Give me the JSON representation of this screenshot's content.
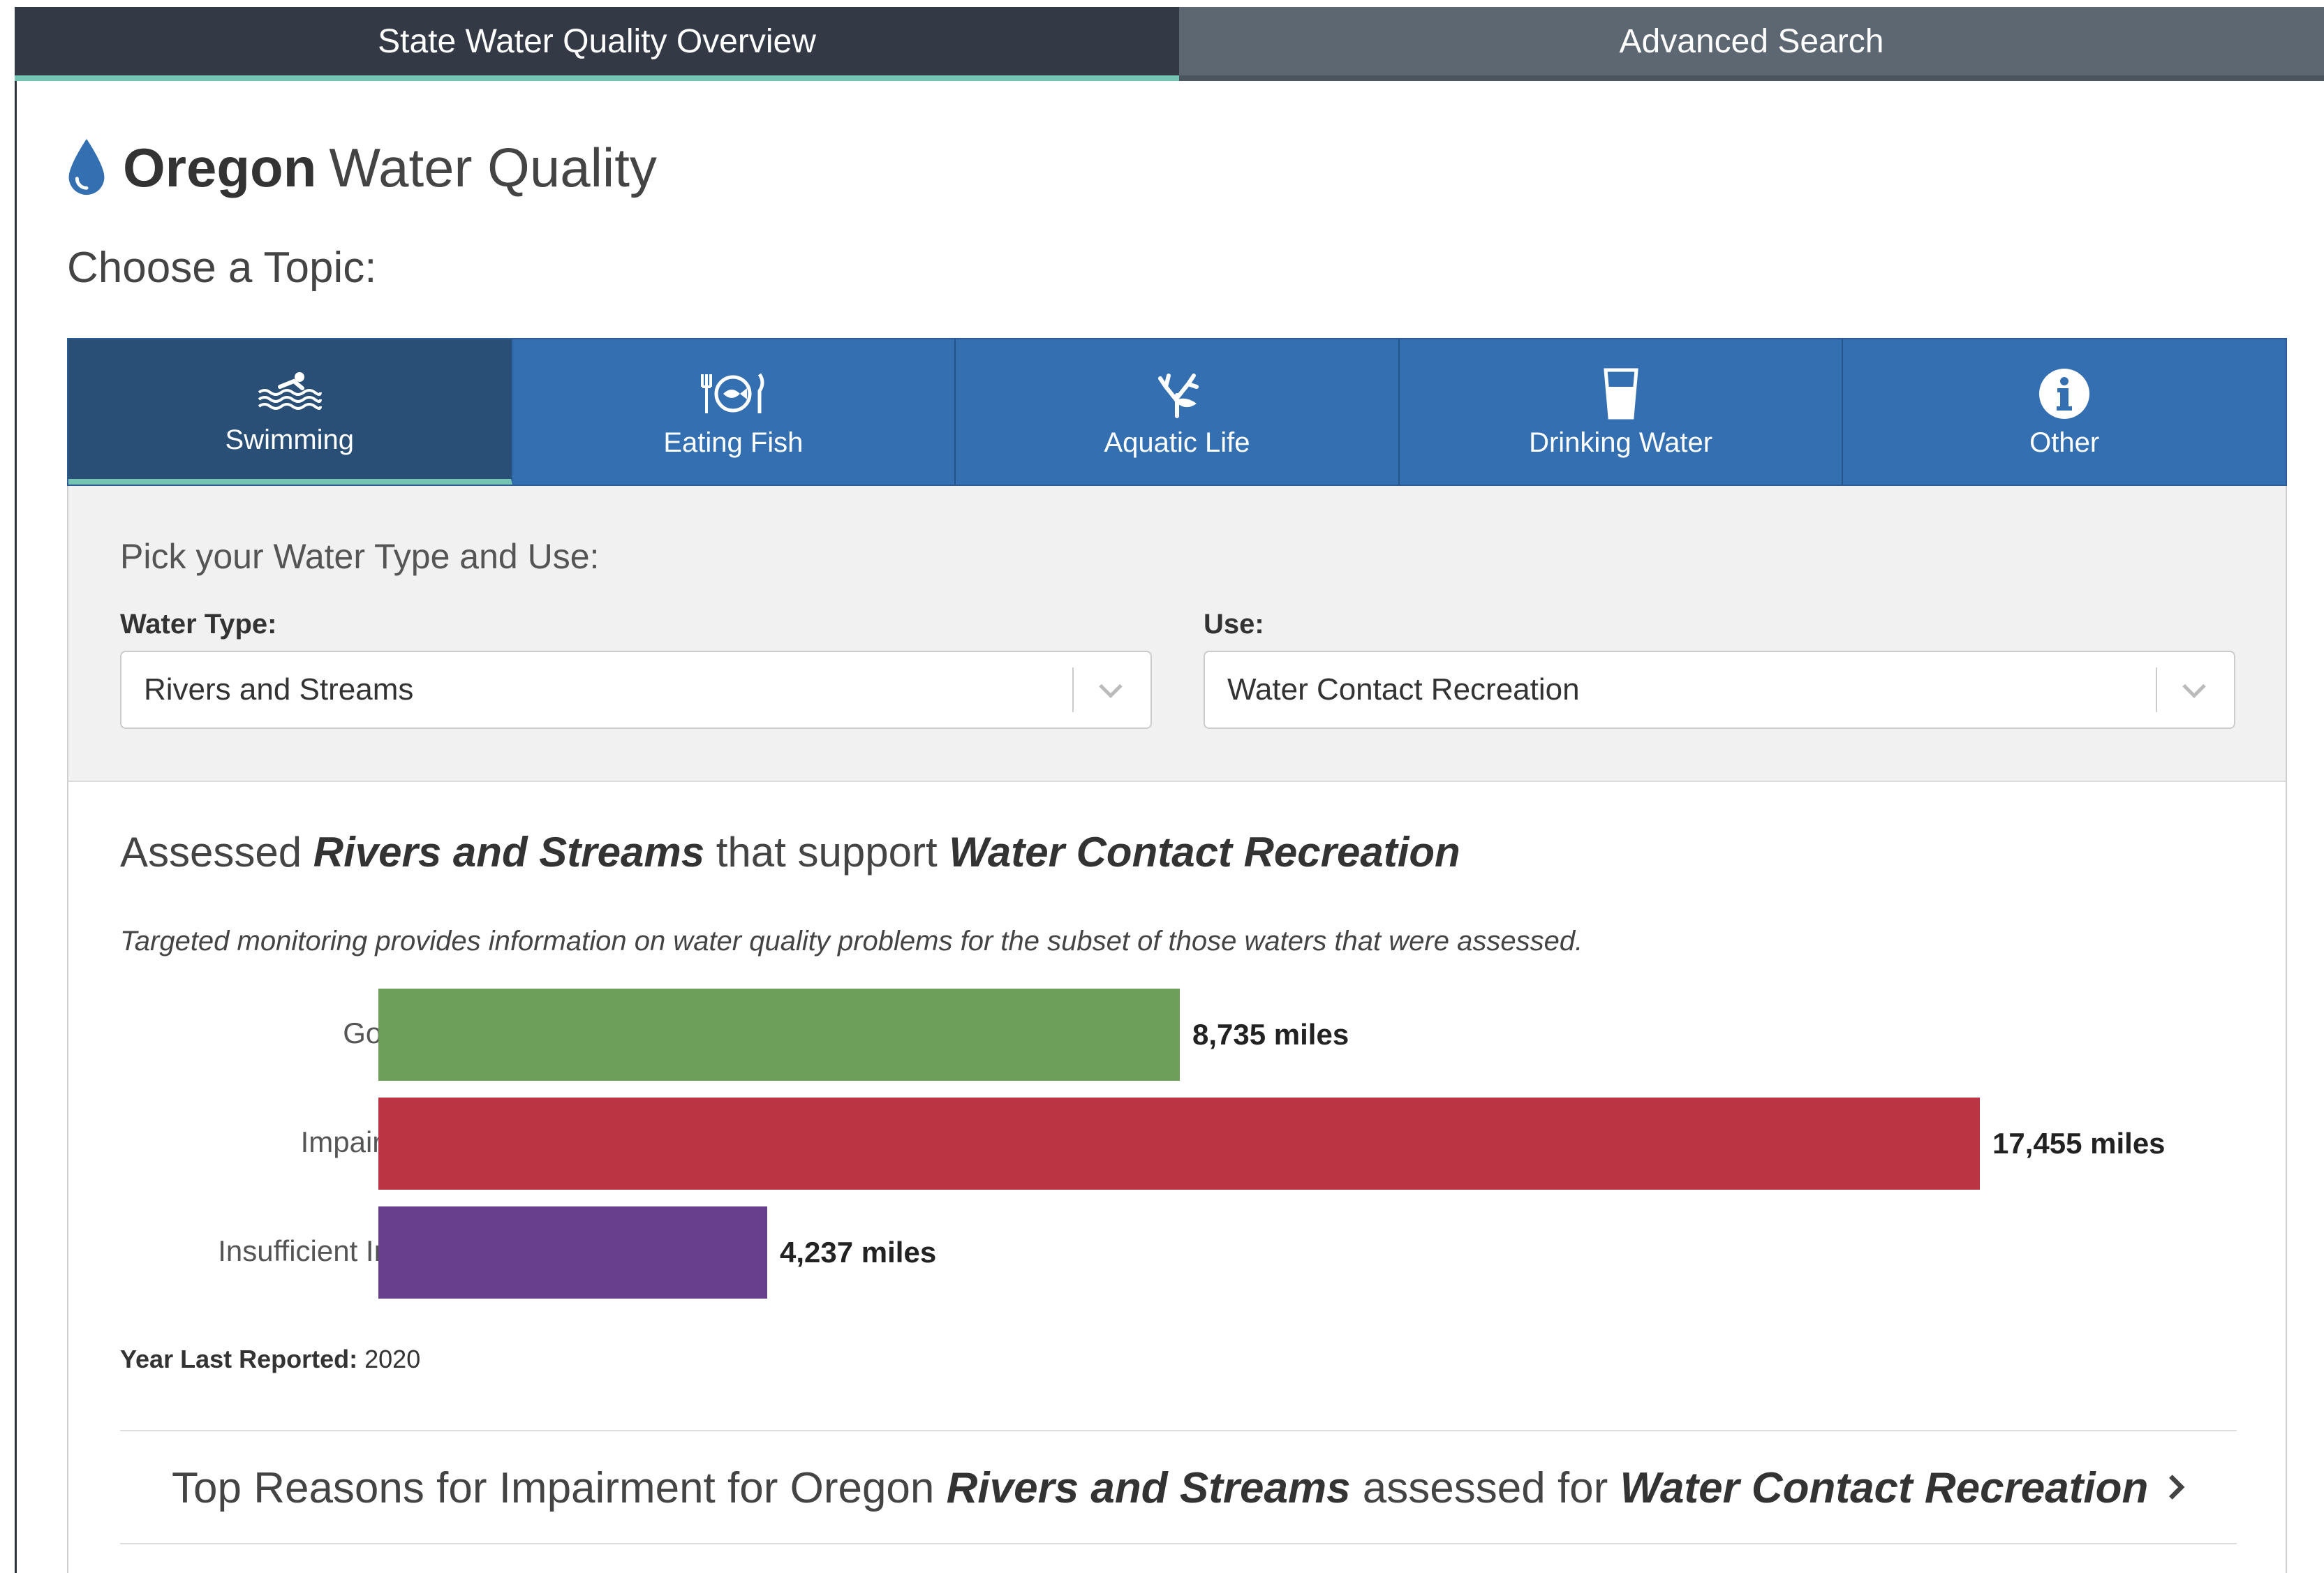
{
  "top_tabs": [
    {
      "label": "State Water Quality Overview",
      "active": true
    },
    {
      "label": "Advanced Search",
      "active": false
    }
  ],
  "header": {
    "state": "Oregon",
    "title_rest": "Water Quality"
  },
  "choose_label": "Choose a Topic:",
  "topics": [
    {
      "label": "Swimming",
      "icon": "swimmer-icon",
      "active": true
    },
    {
      "label": "Eating Fish",
      "icon": "fish-plate-icon",
      "active": false
    },
    {
      "label": "Aquatic Life",
      "icon": "coral-icon",
      "active": false
    },
    {
      "label": "Drinking Water",
      "icon": "water-glass-icon",
      "active": false
    },
    {
      "label": "Other",
      "icon": "info-icon",
      "active": false
    }
  ],
  "filters": {
    "prompt": "Pick your Water Type and Use:",
    "water_type_label": "Water Type:",
    "water_type_value": "Rivers and Streams",
    "use_label": "Use:",
    "use_value": "Water Contact Recreation"
  },
  "summary": {
    "prefix": "Assessed ",
    "water_type": "Rivers and Streams",
    "middle": " that support ",
    "use": "Water Contact Recreation",
    "note": "Targeted monitoring provides information on water quality problems for the subset of those waters that were assessed."
  },
  "chart_data": {
    "type": "bar",
    "orientation": "horizontal",
    "categories": [
      "Good",
      "Impaired",
      "Insufficient Info"
    ],
    "values": [
      8735,
      17455,
      4237
    ],
    "value_labels": [
      "8,735 miles",
      "17,455 miles",
      "4,237 miles"
    ],
    "colors": [
      "#6d9f5b",
      "#bb3443",
      "#663f8d"
    ],
    "unit": "miles"
  },
  "year_reported": {
    "label": "Year Last Reported:",
    "value": "2020"
  },
  "accordion": {
    "prefix": "Top Reasons for Impairment for Oregon ",
    "water_type": "Rivers and Streams",
    "middle": " assessed for ",
    "use": "Water Contact Recreation"
  },
  "colors": {
    "top_tab_active": "#343a45",
    "top_tab_inactive": "#5c6771",
    "accent": "#76c4b4",
    "topic_bg": "#3470b1",
    "topic_active": "#2a4f77"
  }
}
